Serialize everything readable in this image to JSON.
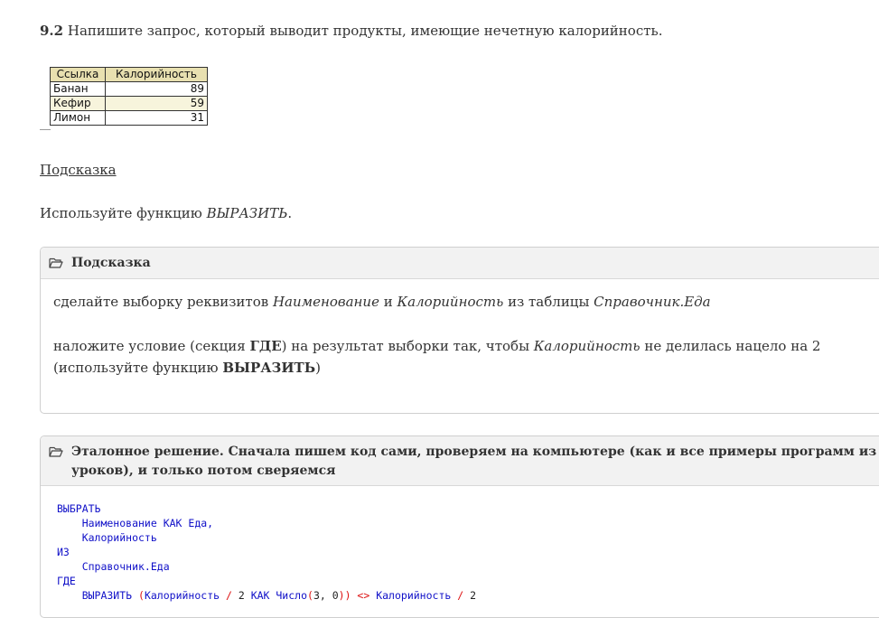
{
  "task": {
    "number": "9.2",
    "text": "Напишите запрос, который выводит продукты, имеющие нечетную калорийность."
  },
  "table": {
    "headers": [
      "Ссылка",
      "Калорийность"
    ],
    "rows": [
      {
        "name": "Банан",
        "cal": "89"
      },
      {
        "name": "Кефир",
        "cal": "59"
      },
      {
        "name": "Лимон",
        "cal": "31"
      }
    ]
  },
  "hint_link": "Подсказка",
  "use_func": {
    "prefix": "Используйте функцию ",
    "func": "ВЫРАЗИТЬ",
    "suffix": "."
  },
  "hint_box": {
    "title": "Подсказка",
    "p1": {
      "a": "сделайте выборку реквизитов ",
      "b": "Наименование",
      "c": " и ",
      "d": "Калорийность",
      "e": " из таблицы ",
      "f": "Справочник.Еда"
    },
    "p2": {
      "a": "наложите условие (секция ",
      "b": "ГДЕ",
      "c": ") на результат выборки так, чтобы ",
      "d": "Калорийность",
      "e": " не делилась нацело на 2 (используйте функцию ",
      "f": "ВЫРАЗИТЬ",
      "g": ")"
    }
  },
  "solution_box": {
    "title": "Эталонное решение. Сначала пишем код сами, проверяем на компьютере (как и все примеры программ из уроков), и только потом сверяемся"
  },
  "code": {
    "l1": "ВЫБРАТЬ",
    "l2": "    Наименование КАК Еда,",
    "l3": "    Калорийность",
    "l4": "ИЗ",
    "l5": "    Справочник.Еда",
    "l6": "ГДЕ",
    "l7a": "    ВЫРАЗИТЬ ",
    "l7b": "(",
    "l7c": "Калорийность ",
    "l7d": "/",
    "l7e": " 2 ",
    "l7f": "КАК Число",
    "l7g": "(",
    "l7h": "3, 0",
    "l7i": "))",
    "l7j": " <> ",
    "l7k": "Калорийность ",
    "l7l": "/",
    "l7m": " 2"
  },
  "colors": {
    "keyword": "#1010c8",
    "operator": "#dd1111",
    "header_bg": "#e8e0b0",
    "row_alt": "#f7f4dc"
  },
  "icons": {
    "box_icon": "folder-open-icon"
  }
}
